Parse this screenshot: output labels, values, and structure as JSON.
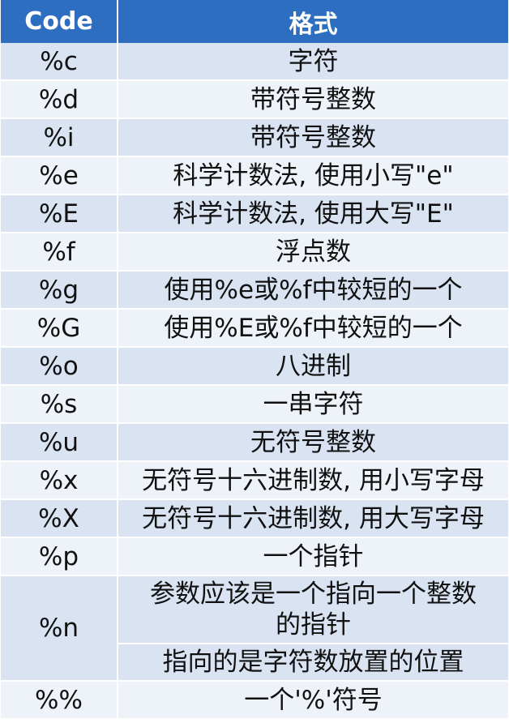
{
  "header": {
    "code": "Code",
    "format": "格式"
  },
  "rows": [
    {
      "code": "%c",
      "desc": "字符"
    },
    {
      "code": "%d",
      "desc": "带符号整数"
    },
    {
      "code": "%i",
      "desc": "带符号整数"
    },
    {
      "code": "%e",
      "desc": "科学计数法, 使用小写\"e\""
    },
    {
      "code": "%E",
      "desc": "科学计数法, 使用大写\"E\""
    },
    {
      "code": "%f",
      "desc": "浮点数"
    },
    {
      "code": "%g",
      "desc": "使用%e或%f中较短的一个"
    },
    {
      "code": "%G",
      "desc": "使用%E或%f中较短的一个"
    },
    {
      "code": "%o",
      "desc": "八进制"
    },
    {
      "code": "%s",
      "desc": "一串字符"
    },
    {
      "code": "%u",
      "desc": "无符号整数"
    },
    {
      "code": "%x",
      "desc": "无符号十六进制数, 用小写字母"
    },
    {
      "code": "%X",
      "desc": "无符号十六进制数, 用大写字母"
    },
    {
      "code": "%p",
      "desc": "一个指针"
    },
    {
      "code": "%n",
      "desc_line1": "参数应该是一个指向一个整数",
      "desc_line2": "的指针",
      "desc_line3": "指向的是字符数放置的位置"
    },
    {
      "code": "%%",
      "desc": "一个'%'符号"
    }
  ]
}
